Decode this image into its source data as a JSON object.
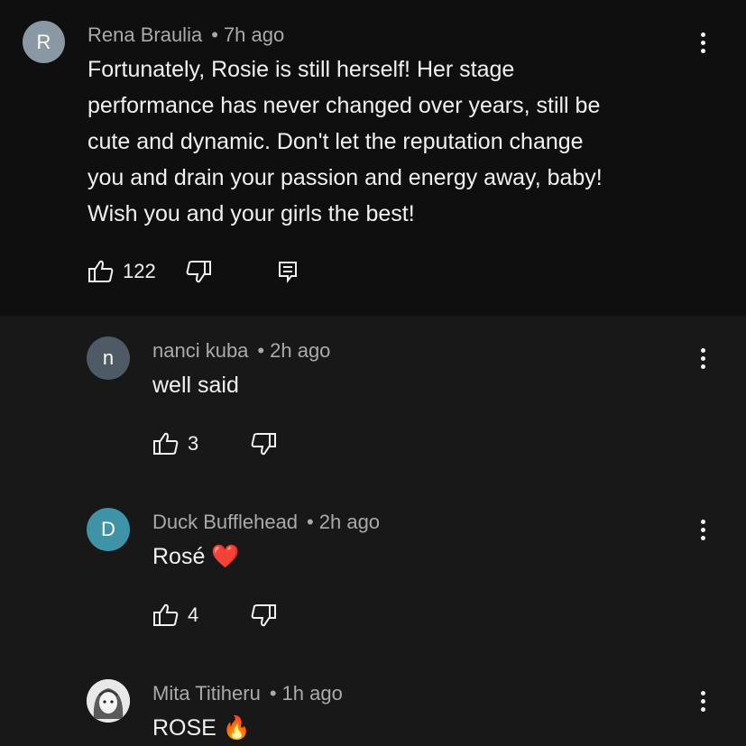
{
  "comments": [
    {
      "avatar_letter": "R",
      "avatar_color": "#8a98a3",
      "author": "Rena Braulia",
      "time": "7h ago",
      "lines": [
        "Fortunately, Rosie is still herself! Her stage",
        "performance has never changed over years, still be",
        "cute and dynamic. Don't let the reputation change",
        "you and drain your passion and energy away, baby!",
        "Wish you and your girls the best!"
      ],
      "likes": "122"
    },
    {
      "avatar_letter": "n",
      "avatar_color": "#4e5a66",
      "author": "nanci kuba",
      "time": "2h ago",
      "text": "well said",
      "likes": "3"
    },
    {
      "avatar_letter": "D",
      "avatar_color": "#3f93a6",
      "author": "Duck Bufflehead",
      "time": "2h ago",
      "text": "Rosé ❤️",
      "likes": "4"
    },
    {
      "avatar_letter": "",
      "avatar_color": "#d9d9d9",
      "author": "Mita Titiheru",
      "time": "1h ago",
      "text": "ROSE 🔥"
    }
  ]
}
